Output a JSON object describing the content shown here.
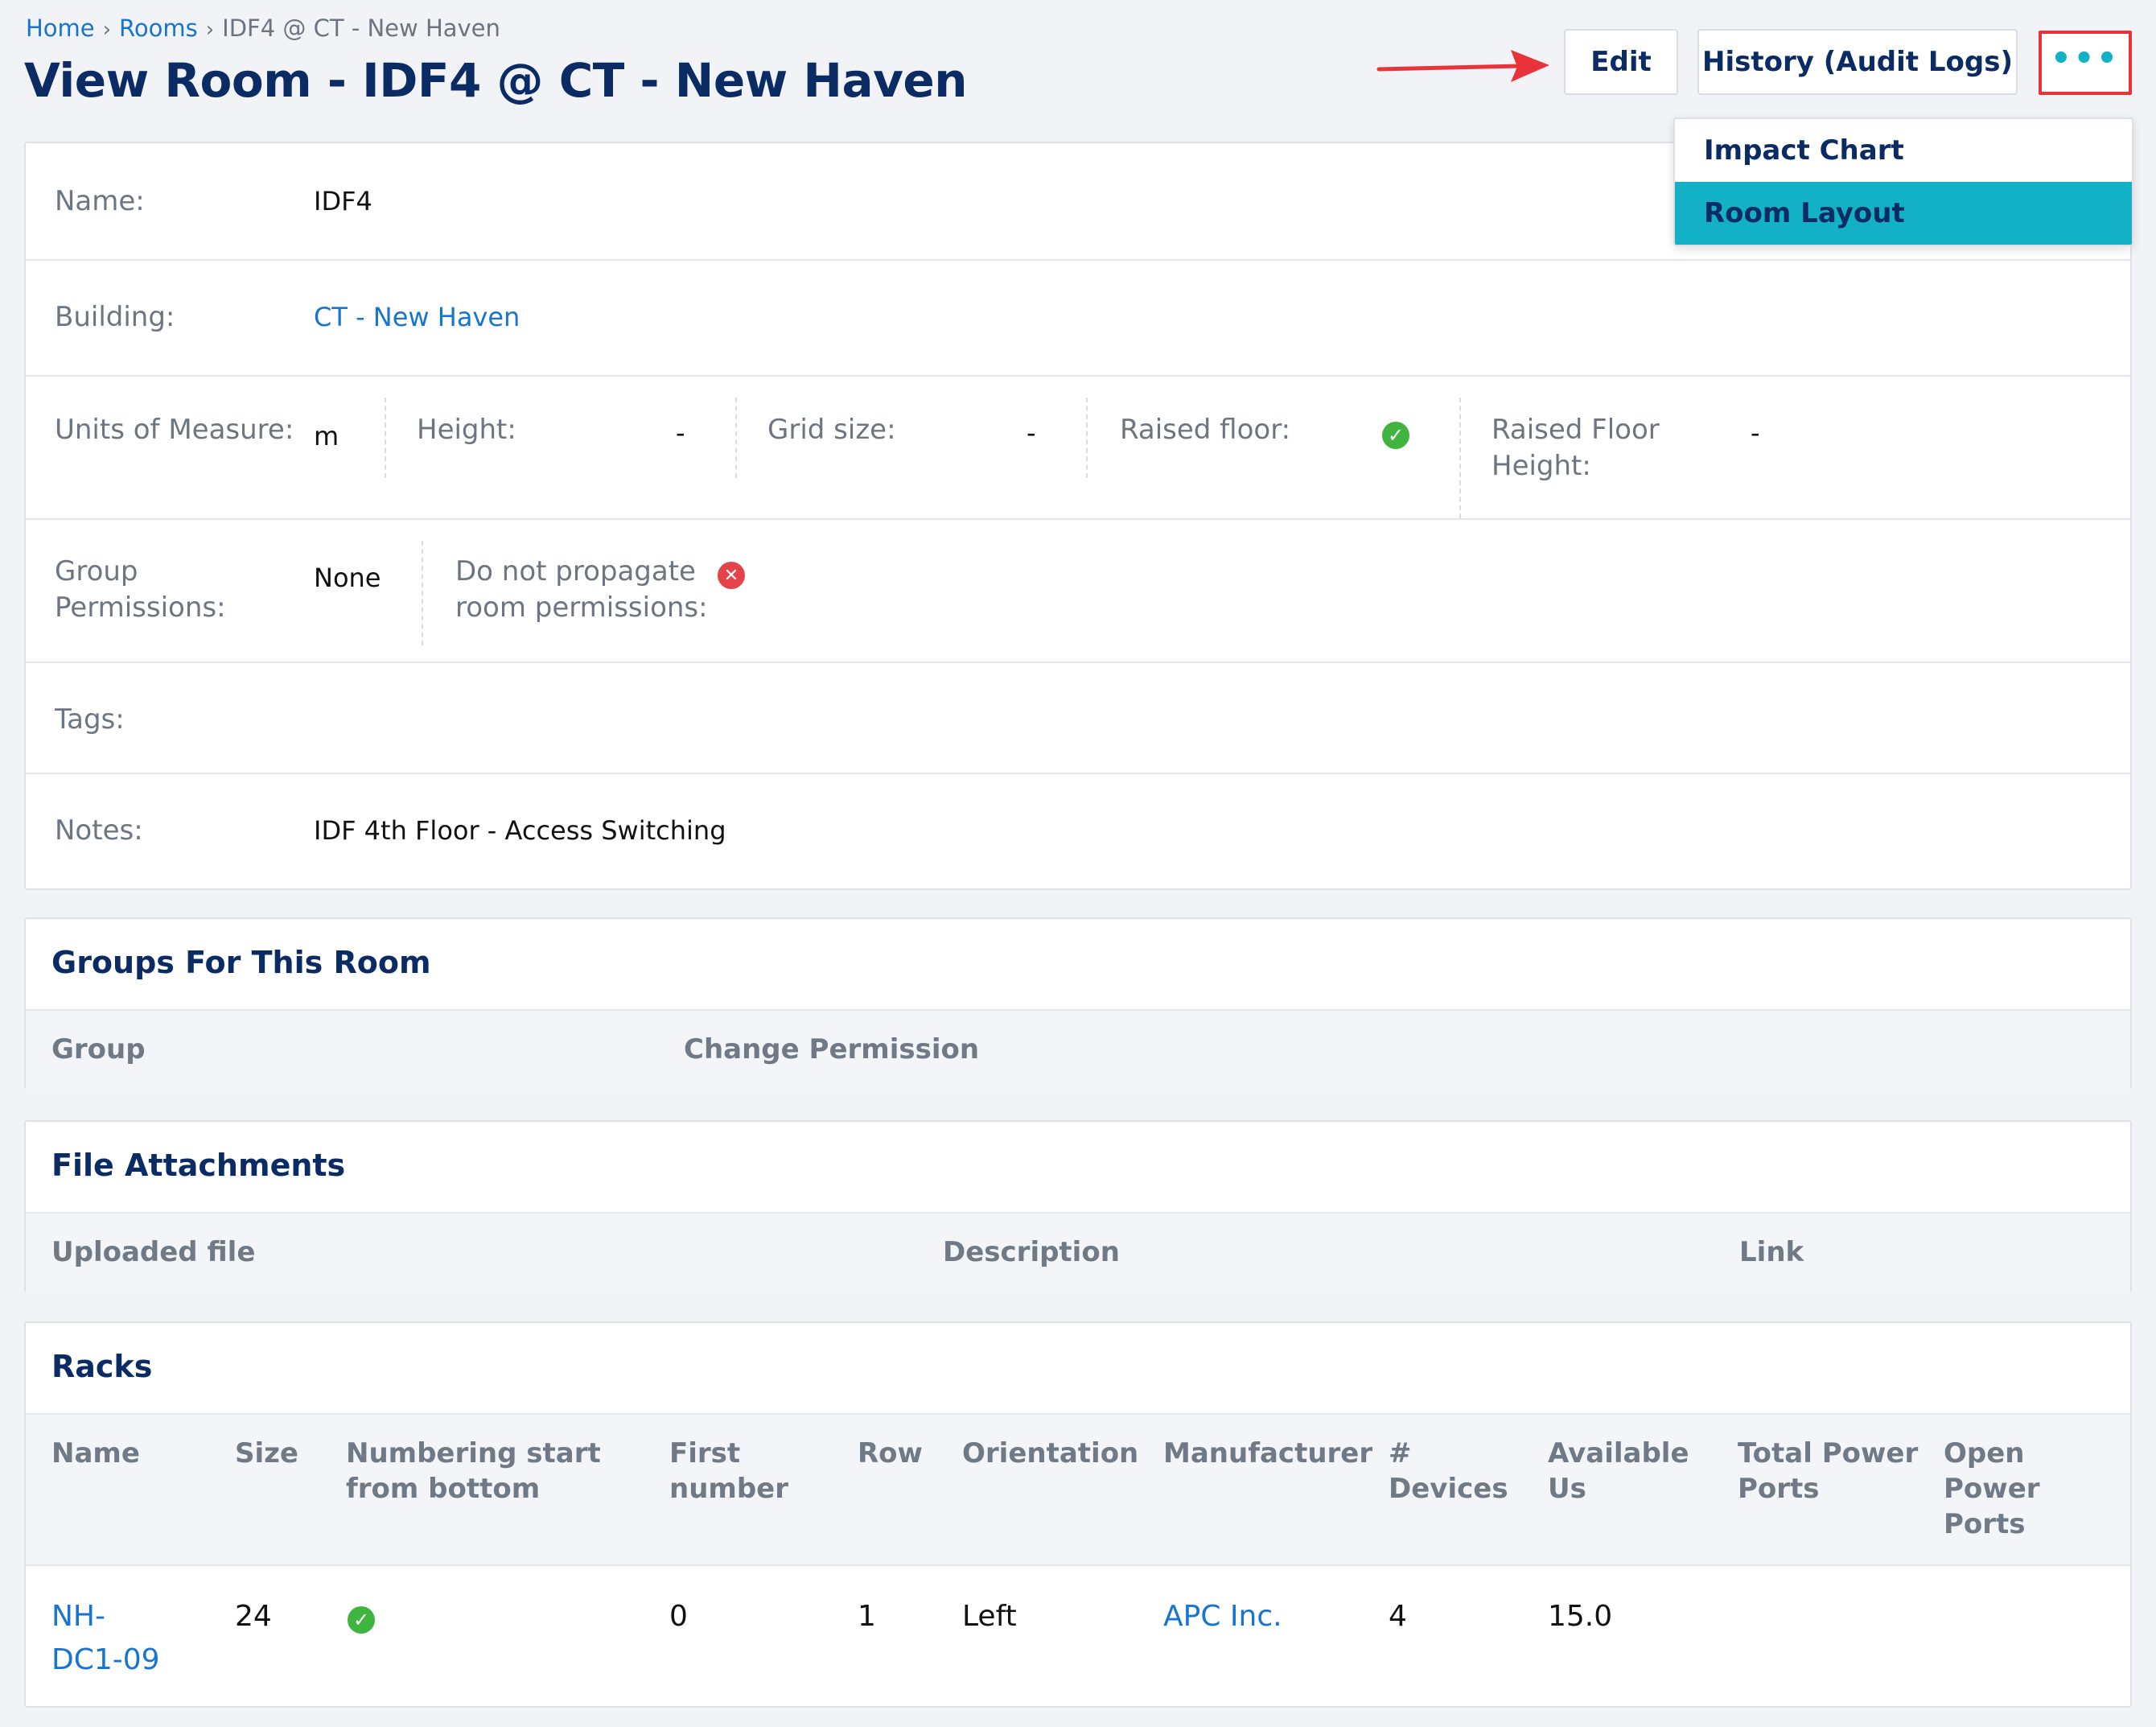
{
  "breadcrumb": {
    "home": "Home",
    "rooms": "Rooms",
    "current": "IDF4 @ CT - New Haven",
    "separator": "›"
  },
  "title": "View Room - IDF4 @ CT - New Haven",
  "actions": {
    "edit": "Edit",
    "history": "History (Audit Logs)",
    "more": "•••"
  },
  "dropdown": {
    "items": [
      "Impact Chart",
      "Room Layout"
    ],
    "highlighted": "Room Layout"
  },
  "details": {
    "name_label": "Name:",
    "name_value": "IDF4",
    "building_label": "Building:",
    "building_value": "CT - New Haven",
    "uom_label": "Units of Measure:",
    "uom_value": "m",
    "height_label": "Height:",
    "height_value": "-",
    "grid_label": "Grid size:",
    "grid_value": "-",
    "raised_floor_label": "Raised floor:",
    "raised_floor_value": true,
    "raised_floor_height_label_1": "Raised Floor",
    "raised_floor_height_label_2": "Height:",
    "raised_floor_height_value": "-",
    "group_perm_label_1": "Group",
    "group_perm_label_2": "Permissions:",
    "group_perm_value": "None",
    "propagate_label_1": "Do not propagate",
    "propagate_label_2": "room permissions:",
    "propagate_value": false,
    "tags_label": "Tags:",
    "notes_label": "Notes:",
    "notes_value": "IDF 4th Floor - Access Switching"
  },
  "groups": {
    "title": "Groups For This Room",
    "columns": [
      "Group",
      "Change Permission"
    ]
  },
  "files": {
    "title": "File Attachments",
    "columns": [
      "Uploaded file",
      "Description",
      "Link"
    ]
  },
  "racks": {
    "title": "Racks",
    "columns": {
      "name": "Name",
      "size": "Size",
      "numbering_1": "Numbering start",
      "numbering_2": "from bottom",
      "first_1": "First",
      "first_2": "number",
      "row": "Row",
      "orientation": "Orientation",
      "manufacturer": "Manufacturer",
      "devices_1": "#",
      "devices_2": "Devices",
      "avail_1": "Available",
      "avail_2": "Us",
      "total_1": "Total Power",
      "total_2": "Ports",
      "open_1": "Open",
      "open_2": "Power",
      "open_3": "Ports"
    },
    "rows": [
      {
        "name_1": "NH-",
        "name_2": "DC1-09",
        "size": "24",
        "numbering_from_bottom": true,
        "first_number": "0",
        "row": "1",
        "orientation": "Left",
        "manufacturer": "APC Inc.",
        "devices": "4",
        "available_us": "15.0",
        "total_power_ports": "",
        "open_power_ports": ""
      }
    ]
  },
  "colors": {
    "title": "#0a2b63",
    "link": "#1874d1",
    "accent": "#12b1c6",
    "highlight_border": "#e8333a",
    "ok": "#3fb43f",
    "error": "#e5434a"
  }
}
